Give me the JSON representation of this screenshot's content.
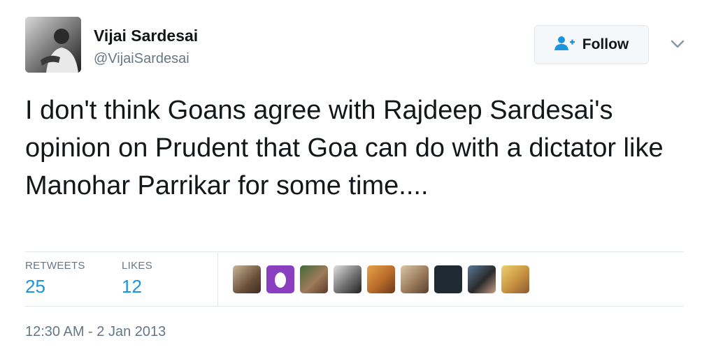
{
  "author": {
    "name": "Vijai Sardesai",
    "handle": "@VijaiSardesai"
  },
  "follow_button": {
    "label": "Follow",
    "icon": "follow-person-icon"
  },
  "tweet": {
    "text": "I don't think Goans agree with Rajdeep Sardesai's opinion on Prudent that Goa can do with a dictator like Manohar Parrikar for some time...."
  },
  "stats": {
    "retweets_label": "RETWEETS",
    "retweets_count": "25",
    "likes_label": "LIKES",
    "likes_count": "12"
  },
  "timestamp": "12:30 AM - 2 Jan 2013",
  "colors": {
    "link_blue": "#1b95e0",
    "secondary_text": "#657786",
    "divider": "#e1e8ed"
  }
}
